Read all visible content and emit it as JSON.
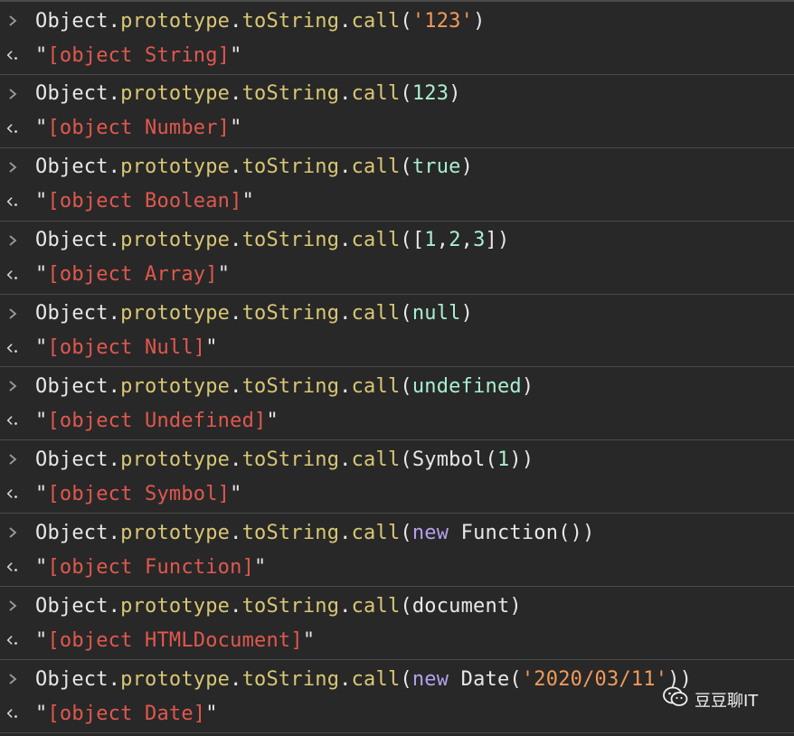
{
  "entries": [
    {
      "tokens": [
        {
          "t": "Object",
          "c": "c-obj"
        },
        {
          "t": ".",
          "c": "c-punc"
        },
        {
          "t": "prototype",
          "c": "c-prop"
        },
        {
          "t": ".",
          "c": "c-punc"
        },
        {
          "t": "toString",
          "c": "c-prop"
        },
        {
          "t": ".",
          "c": "c-punc"
        },
        {
          "t": "call",
          "c": "c-prop"
        },
        {
          "t": "(",
          "c": "c-punc"
        },
        {
          "t": "'123'",
          "c": "c-str"
        },
        {
          "t": ")",
          "c": "c-punc"
        }
      ],
      "result": "[object String]"
    },
    {
      "tokens": [
        {
          "t": "Object",
          "c": "c-obj"
        },
        {
          "t": ".",
          "c": "c-punc"
        },
        {
          "t": "prototype",
          "c": "c-prop"
        },
        {
          "t": ".",
          "c": "c-punc"
        },
        {
          "t": "toString",
          "c": "c-prop"
        },
        {
          "t": ".",
          "c": "c-punc"
        },
        {
          "t": "call",
          "c": "c-prop"
        },
        {
          "t": "(",
          "c": "c-punc"
        },
        {
          "t": "123",
          "c": "c-num"
        },
        {
          "t": ")",
          "c": "c-punc"
        }
      ],
      "result": "[object Number]"
    },
    {
      "tokens": [
        {
          "t": "Object",
          "c": "c-obj"
        },
        {
          "t": ".",
          "c": "c-punc"
        },
        {
          "t": "prototype",
          "c": "c-prop"
        },
        {
          "t": ".",
          "c": "c-punc"
        },
        {
          "t": "toString",
          "c": "c-prop"
        },
        {
          "t": ".",
          "c": "c-punc"
        },
        {
          "t": "call",
          "c": "c-prop"
        },
        {
          "t": "(",
          "c": "c-punc"
        },
        {
          "t": "true",
          "c": "c-num"
        },
        {
          "t": ")",
          "c": "c-punc"
        }
      ],
      "result": "[object Boolean]"
    },
    {
      "tokens": [
        {
          "t": "Object",
          "c": "c-obj"
        },
        {
          "t": ".",
          "c": "c-punc"
        },
        {
          "t": "prototype",
          "c": "c-prop"
        },
        {
          "t": ".",
          "c": "c-punc"
        },
        {
          "t": "toString",
          "c": "c-prop"
        },
        {
          "t": ".",
          "c": "c-punc"
        },
        {
          "t": "call",
          "c": "c-prop"
        },
        {
          "t": "([",
          "c": "c-punc"
        },
        {
          "t": "1",
          "c": "c-num"
        },
        {
          "t": ",",
          "c": "c-punc"
        },
        {
          "t": "2",
          "c": "c-num"
        },
        {
          "t": ",",
          "c": "c-punc"
        },
        {
          "t": "3",
          "c": "c-num"
        },
        {
          "t": "])",
          "c": "c-punc"
        }
      ],
      "result": "[object Array]"
    },
    {
      "tokens": [
        {
          "t": "Object",
          "c": "c-obj"
        },
        {
          "t": ".",
          "c": "c-punc"
        },
        {
          "t": "prototype",
          "c": "c-prop"
        },
        {
          "t": ".",
          "c": "c-punc"
        },
        {
          "t": "toString",
          "c": "c-prop"
        },
        {
          "t": ".",
          "c": "c-punc"
        },
        {
          "t": "call",
          "c": "c-prop"
        },
        {
          "t": "(",
          "c": "c-punc"
        },
        {
          "t": "null",
          "c": "c-num"
        },
        {
          "t": ")",
          "c": "c-punc"
        }
      ],
      "result": "[object Null]"
    },
    {
      "tokens": [
        {
          "t": "Object",
          "c": "c-obj"
        },
        {
          "t": ".",
          "c": "c-punc"
        },
        {
          "t": "prototype",
          "c": "c-prop"
        },
        {
          "t": ".",
          "c": "c-punc"
        },
        {
          "t": "toString",
          "c": "c-prop"
        },
        {
          "t": ".",
          "c": "c-punc"
        },
        {
          "t": "call",
          "c": "c-prop"
        },
        {
          "t": "(",
          "c": "c-punc"
        },
        {
          "t": "undefined",
          "c": "c-num"
        },
        {
          "t": ")",
          "c": "c-punc"
        }
      ],
      "result": "[object Undefined]"
    },
    {
      "tokens": [
        {
          "t": "Object",
          "c": "c-obj"
        },
        {
          "t": ".",
          "c": "c-punc"
        },
        {
          "t": "prototype",
          "c": "c-prop"
        },
        {
          "t": ".",
          "c": "c-punc"
        },
        {
          "t": "toString",
          "c": "c-prop"
        },
        {
          "t": ".",
          "c": "c-punc"
        },
        {
          "t": "call",
          "c": "c-prop"
        },
        {
          "t": "(Symbol(",
          "c": "c-punc"
        },
        {
          "t": "1",
          "c": "c-num"
        },
        {
          "t": "))",
          "c": "c-punc"
        }
      ],
      "result": "[object Symbol]"
    },
    {
      "tokens": [
        {
          "t": "Object",
          "c": "c-obj"
        },
        {
          "t": ".",
          "c": "c-punc"
        },
        {
          "t": "prototype",
          "c": "c-prop"
        },
        {
          "t": ".",
          "c": "c-punc"
        },
        {
          "t": "toString",
          "c": "c-prop"
        },
        {
          "t": ".",
          "c": "c-punc"
        },
        {
          "t": "call",
          "c": "c-prop"
        },
        {
          "t": "(",
          "c": "c-punc"
        },
        {
          "t": "new",
          "c": "c-kw"
        },
        {
          "t": " Function())",
          "c": "c-punc"
        }
      ],
      "result": "[object Function]"
    },
    {
      "tokens": [
        {
          "t": "Object",
          "c": "c-obj"
        },
        {
          "t": ".",
          "c": "c-punc"
        },
        {
          "t": "prototype",
          "c": "c-prop"
        },
        {
          "t": ".",
          "c": "c-punc"
        },
        {
          "t": "toString",
          "c": "c-prop"
        },
        {
          "t": ".",
          "c": "c-punc"
        },
        {
          "t": "call",
          "c": "c-prop"
        },
        {
          "t": "(document)",
          "c": "c-punc"
        }
      ],
      "result": "[object HTMLDocument]"
    },
    {
      "tokens": [
        {
          "t": "Object",
          "c": "c-obj"
        },
        {
          "t": ".",
          "c": "c-punc"
        },
        {
          "t": "prototype",
          "c": "c-prop"
        },
        {
          "t": ".",
          "c": "c-punc"
        },
        {
          "t": "toString",
          "c": "c-prop"
        },
        {
          "t": ".",
          "c": "c-punc"
        },
        {
          "t": "call",
          "c": "c-prop"
        },
        {
          "t": "(",
          "c": "c-punc"
        },
        {
          "t": "new",
          "c": "c-kw"
        },
        {
          "t": " Date(",
          "c": "c-punc"
        },
        {
          "t": "'2020/03/11'",
          "c": "c-str"
        },
        {
          "t": "))",
          "c": "c-punc"
        }
      ],
      "result": "[object Date]"
    }
  ],
  "watermark": {
    "text": "豆豆聊IT",
    "icon": "wechat-icon"
  },
  "colors": {
    "background": "#282828",
    "property": "#d9c774",
    "string": "#f19a5b",
    "number": "#a9efcf",
    "keyword": "#b6a0ee",
    "result": "#e0584e"
  }
}
